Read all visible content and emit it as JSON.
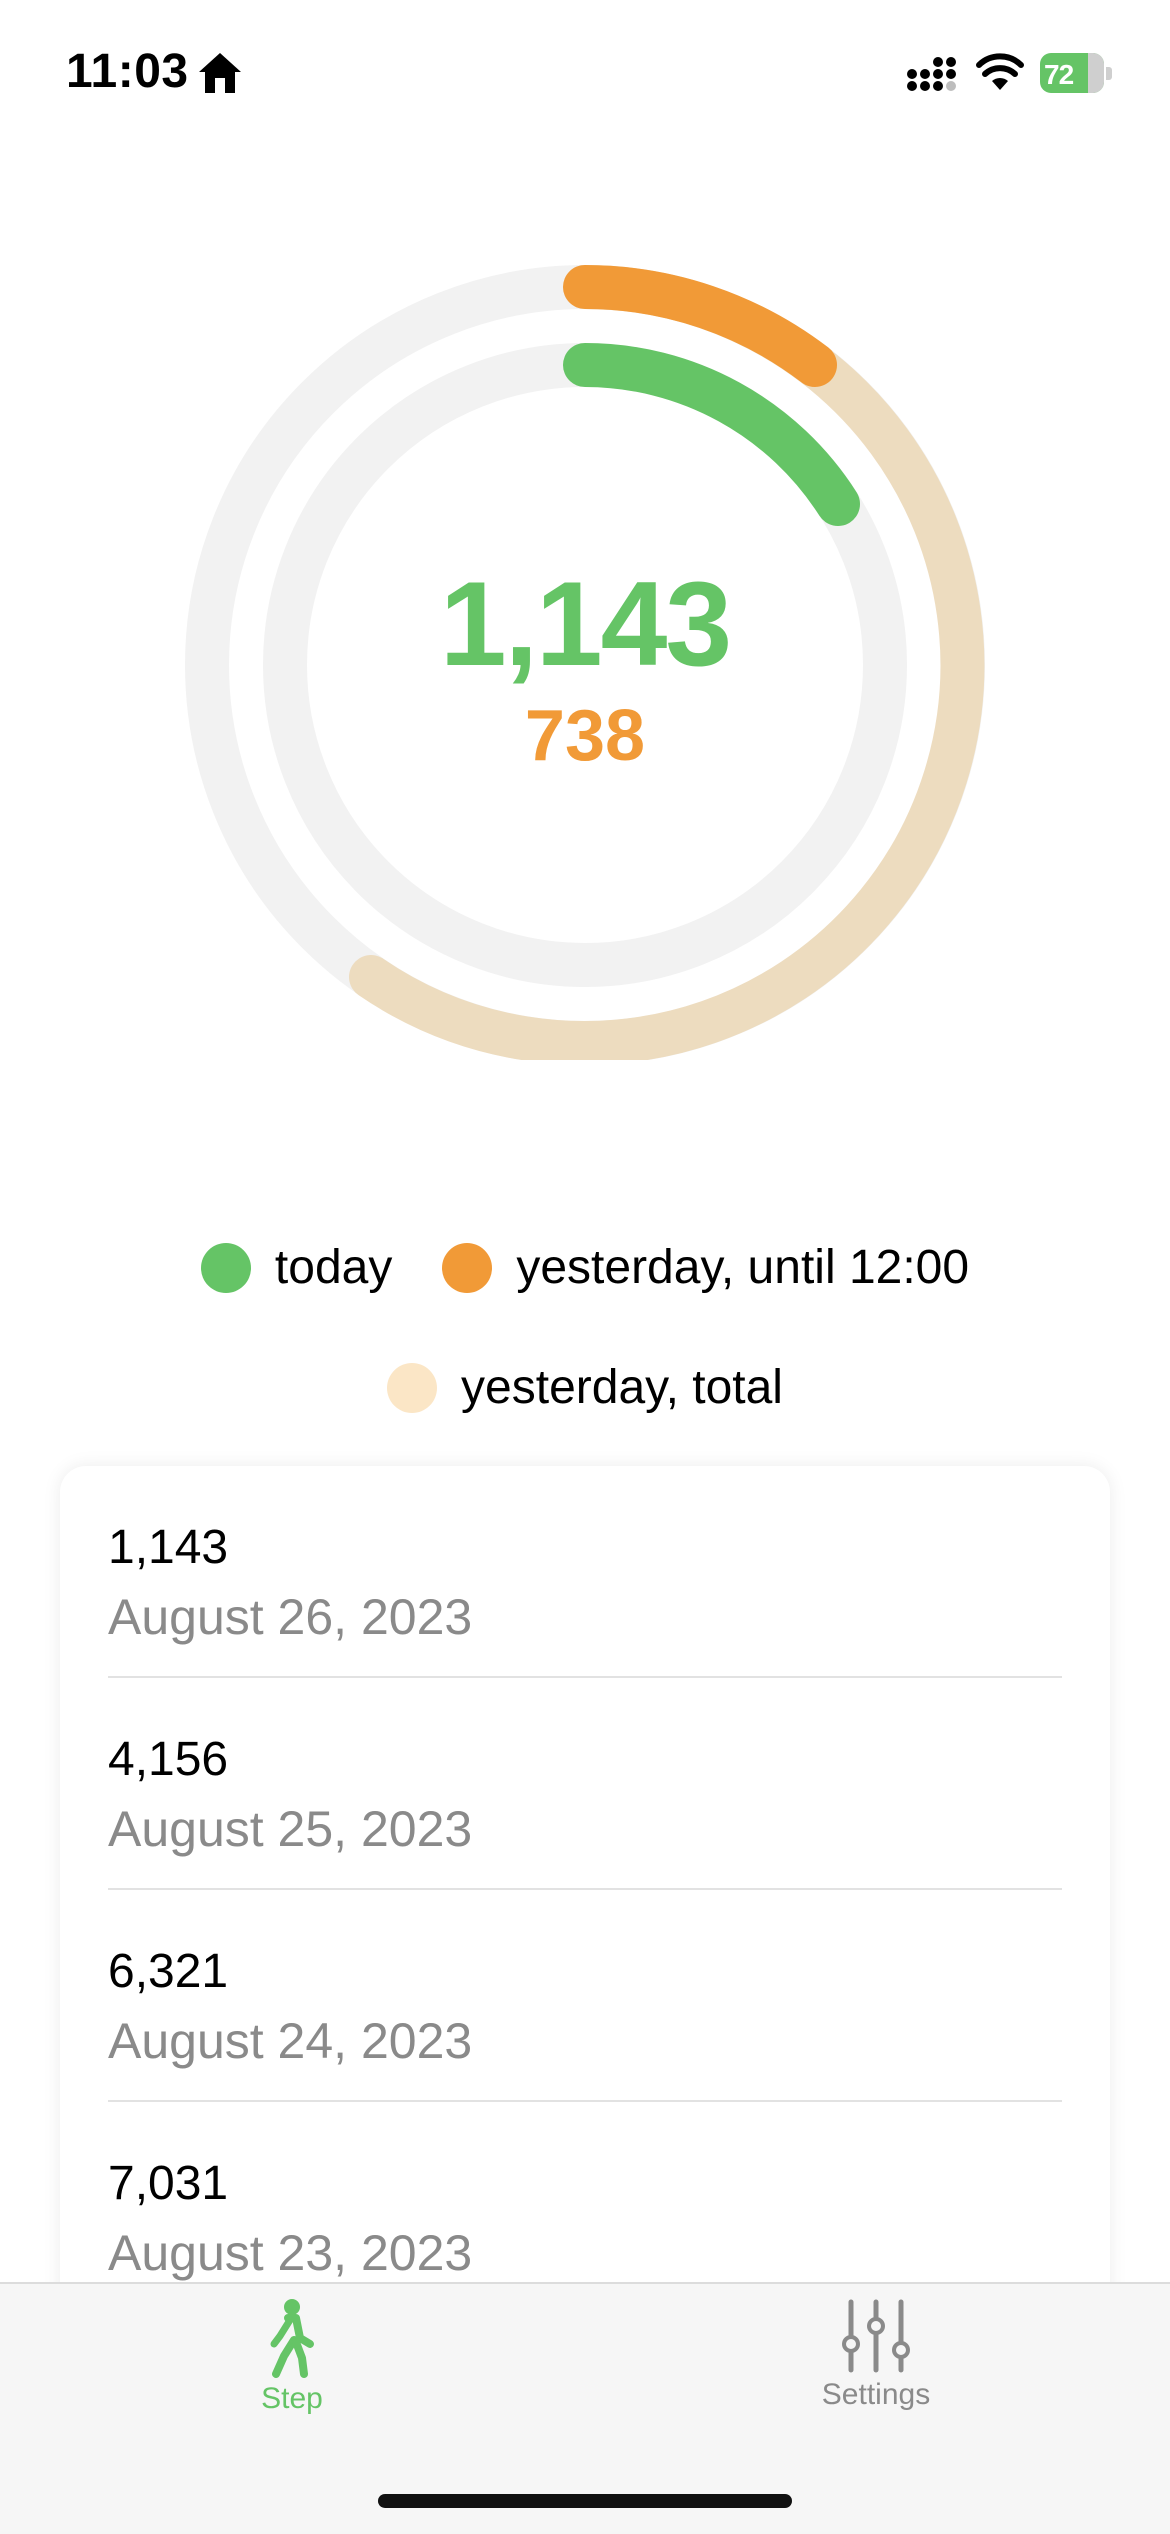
{
  "status_bar": {
    "time": "11:03",
    "battery": "72"
  },
  "rings": {
    "today_value": "1,143",
    "yesterday_value": "738",
    "colors": {
      "today": "#65c466",
      "yesterday_until": "#f19a37",
      "yesterday_total": "#eddcbf",
      "track": "#f2f2f2"
    }
  },
  "legend": {
    "today": "today",
    "yesterday_until": "yesterday, until 12:00",
    "yesterday_total": "yesterday, total"
  },
  "history": [
    {
      "steps": "1,143",
      "date": "August 26, 2023"
    },
    {
      "steps": "4,156",
      "date": "August 25, 2023"
    },
    {
      "steps": "6,321",
      "date": "August 24, 2023"
    },
    {
      "steps": "7,031",
      "date": "August 23, 2023"
    }
  ],
  "tabs": [
    {
      "label": "Step",
      "icon": "walking-figure-icon",
      "active": true
    },
    {
      "label": "Settings",
      "icon": "sliders-icon",
      "active": false
    }
  ]
}
